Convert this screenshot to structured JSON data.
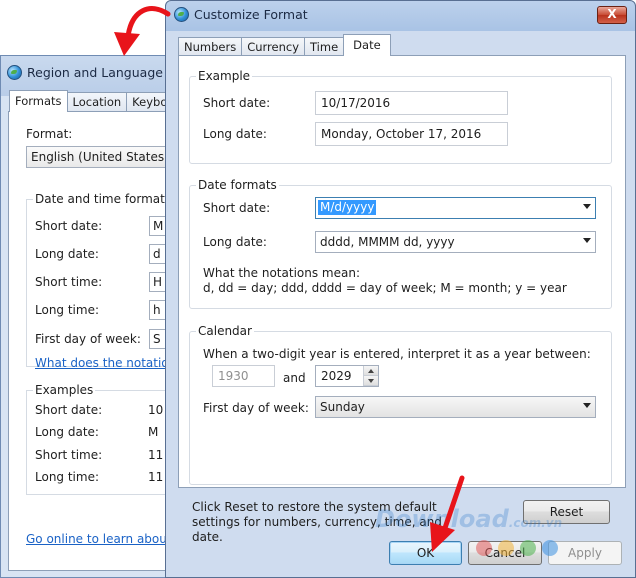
{
  "background_window": {
    "title": "Region and Language",
    "tabs": [
      "Formats",
      "Location",
      "Keyboard"
    ],
    "format_label": "Format:",
    "format_value": "English (United States)",
    "date_time_group": "Date and time formats",
    "rows": [
      {
        "label": "Short date:",
        "value": "M"
      },
      {
        "label": "Long date:",
        "value": "d"
      },
      {
        "label": "Short time:",
        "value": "H"
      },
      {
        "label": "Long time:",
        "value": "h"
      },
      {
        "label": "First day of week:",
        "value": "S"
      }
    ],
    "notation_link": "What does the notation",
    "examples_group": "Examples",
    "examples": [
      {
        "label": "Short date:",
        "value": "10"
      },
      {
        "label": "Long date:",
        "value": "M"
      },
      {
        "label": "Short time:",
        "value": "11"
      },
      {
        "label": "Long time:",
        "value": "11"
      }
    ],
    "online_link": "Go online to learn about c"
  },
  "dialog": {
    "title": "Customize Format",
    "close_label": "X",
    "tabs": [
      "Numbers",
      "Currency",
      "Time",
      "Date"
    ],
    "example": {
      "group_title": "Example",
      "short_label": "Short date:",
      "short_value": "10/17/2016",
      "long_label": "Long date:",
      "long_value": "Monday, October 17, 2016"
    },
    "date_formats": {
      "group_title": "Date formats",
      "short_label": "Short date:",
      "short_value": "M/d/yyyy",
      "long_label": "Long date:",
      "long_value": "dddd, MMMM dd, yyyy",
      "notation_title": "What the notations mean:",
      "notation_text": "d, dd = day;  ddd, dddd = day of week;  M = month;  y = year"
    },
    "calendar": {
      "group_title": "Calendar",
      "two_digit_label": "When a two-digit year is entered, interpret it as a year between:",
      "year_from": "1930",
      "and_label": "and",
      "year_to": "2029",
      "first_day_label": "First day of week:",
      "first_day_value": "Sunday"
    },
    "reset_text": "Click Reset to restore the system default settings for numbers, currency, time, and date.",
    "reset_button": "Reset",
    "ok_button": "OK",
    "cancel_button": "Cancel",
    "apply_button": "Apply"
  },
  "watermark": {
    "brand": "Download",
    "suffix": ".com.vn"
  },
  "colors": {
    "annotation_red": "#e8141a",
    "selection": "#3399ff",
    "link": "#1a62c6"
  }
}
